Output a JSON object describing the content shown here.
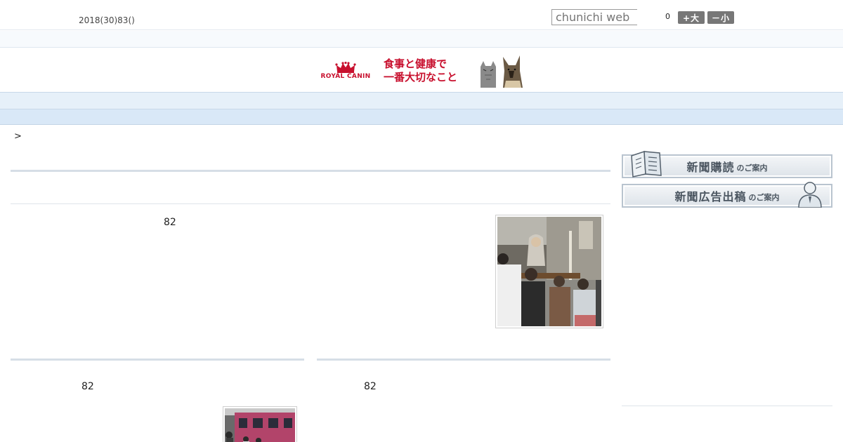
{
  "header": {
    "date": "2018(30)83()",
    "search_placeholder": "chunichi web",
    "counter": "0",
    "font_bigger": "+大",
    "font_smaller": "－小"
  },
  "ad": {
    "brand": "ROYAL CANIN",
    "copy_line1": "食事と健康で",
    "copy_line2": "一番大切なこと",
    "brand_color": "#c8102e"
  },
  "nav": {
    "items": [
      "",
      "",
      "",
      "",
      "",
      "",
      "",
      "",
      ""
    ]
  },
  "breadcrumb": ">",
  "articles": {
    "lead_number": "82",
    "left_number": "82",
    "right_number": "82"
  },
  "sidebar": {
    "subscribe_main": "新聞購読",
    "subscribe_sub": "のご案内",
    "advertise_main": "新聞広告出稿",
    "advertise_sub": "のご案内"
  }
}
